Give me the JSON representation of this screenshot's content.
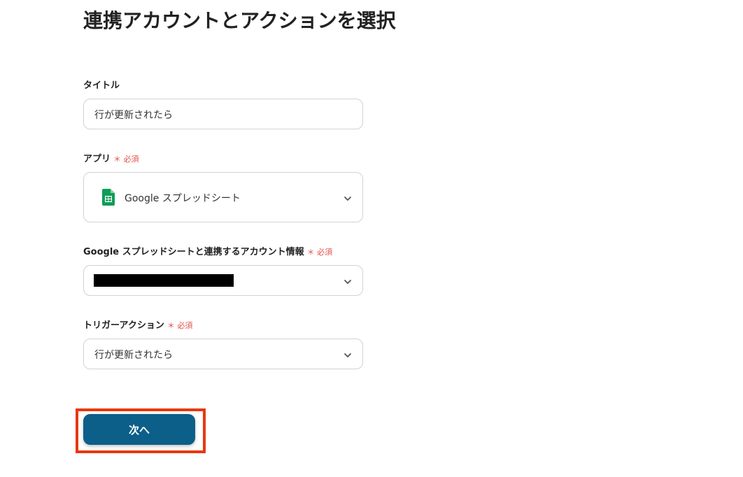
{
  "page": {
    "title": "連携アカウントとアクションを選択"
  },
  "form": {
    "title_field": {
      "label": "タイトル",
      "value": "行が更新されたら"
    },
    "app_field": {
      "label": "アプリ",
      "required": "＊ 必須",
      "value": "Google スプレッドシート",
      "icon": "google-sheets-icon"
    },
    "account_field": {
      "label": "Google スプレッドシートと連携するアカウント情報",
      "required": "＊ 必須"
    },
    "trigger_field": {
      "label": "トリガーアクション",
      "required": "＊ 必須",
      "value": "行が更新されたら"
    }
  },
  "actions": {
    "next_label": "次へ"
  },
  "colors": {
    "primary": "#0b5f88",
    "required": "#e0504a",
    "highlight": "#e8380d",
    "border": "#cfd3d8"
  }
}
